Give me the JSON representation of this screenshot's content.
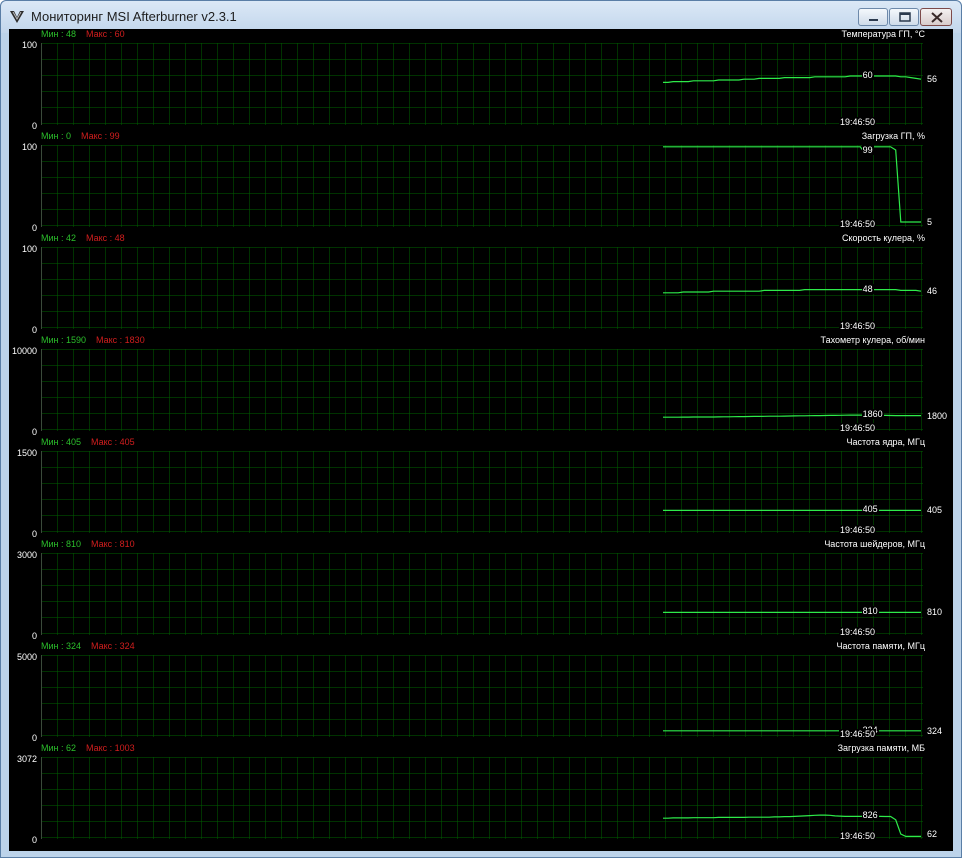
{
  "window": {
    "title": "Мониторинг MSI Afterburner v2.3.1"
  },
  "graph_color": "#2eea4a",
  "panels": [
    {
      "title": "Температура ГП, °C",
      "min_label": "Мин : 48",
      "max_label": "Макс : 60",
      "ymax": "100",
      "ymin": "0",
      "current": "60",
      "last": "56",
      "time": "19:46:50",
      "scale_max": 100,
      "series": [
        52,
        52,
        53,
        53,
        53,
        53,
        54,
        54,
        54,
        54,
        54,
        55,
        55,
        55,
        55,
        55,
        56,
        56,
        56,
        57,
        57,
        57,
        57,
        57,
        58,
        58,
        58,
        58,
        58,
        58,
        59,
        59,
        59,
        59,
        59,
        59,
        59,
        60,
        60,
        60,
        60,
        60,
        60,
        60,
        60,
        60,
        60,
        59,
        59,
        58,
        57,
        56
      ]
    },
    {
      "title": "Загрузка ГП, %",
      "min_label": "Мин : 0",
      "max_label": "Макс : 99",
      "ymax": "100",
      "ymin": "0",
      "current": "99",
      "last": "5",
      "time": "19:46:50",
      "scale_max": 100,
      "series": [
        99,
        99,
        99,
        99,
        99,
        99,
        99,
        99,
        99,
        99,
        99,
        99,
        99,
        99,
        99,
        99,
        99,
        99,
        99,
        99,
        99,
        99,
        99,
        99,
        99,
        99,
        99,
        99,
        99,
        99,
        99,
        99,
        99,
        99,
        99,
        99,
        99,
        99,
        99,
        99,
        90,
        99,
        99,
        99,
        99,
        99,
        95,
        5,
        5,
        5,
        5,
        5
      ]
    },
    {
      "title": "Скорость кулера, %",
      "min_label": "Мин : 42",
      "max_label": "Макс : 48",
      "ymax": "100",
      "ymin": "0",
      "current": "48",
      "last": "46",
      "time": "19:46:50",
      "scale_max": 100,
      "series": [
        44,
        44,
        44,
        44,
        45,
        45,
        45,
        45,
        45,
        45,
        46,
        46,
        46,
        46,
        46,
        46,
        46,
        46,
        46,
        46,
        47,
        47,
        47,
        47,
        47,
        47,
        47,
        47,
        48,
        48,
        48,
        48,
        48,
        48,
        48,
        48,
        48,
        48,
        48,
        48,
        48,
        48,
        48,
        48,
        48,
        48,
        48,
        47,
        47,
        47,
        47,
        46
      ]
    },
    {
      "title": "Тахометр кулера, об/мин",
      "min_label": "Мин : 1590",
      "max_label": "Макс : 1830",
      "ymax": "10000",
      "ymin": "0",
      "current": "1860",
      "last": "1800",
      "time": "19:46:50",
      "scale_max": 10000,
      "series": [
        1600,
        1600,
        1600,
        1600,
        1610,
        1610,
        1620,
        1620,
        1620,
        1630,
        1630,
        1640,
        1650,
        1650,
        1660,
        1670,
        1680,
        1690,
        1700,
        1700,
        1710,
        1720,
        1730,
        1730,
        1740,
        1750,
        1760,
        1770,
        1780,
        1790,
        1800,
        1800,
        1810,
        1820,
        1830,
        1840,
        1850,
        1860,
        1860,
        1860,
        1860,
        1850,
        1840,
        1830,
        1820,
        1810,
        1800,
        1800,
        1800,
        1800,
        1800,
        1800
      ]
    },
    {
      "title": "Частота ядра, МГц",
      "min_label": "Мин : 405",
      "max_label": "Макс : 405",
      "ymax": "1500",
      "ymin": "0",
      "current": "405",
      "last": "405",
      "time": "19:46:50",
      "scale_max": 1500,
      "series": [
        405,
        405,
        405,
        405,
        405,
        405,
        405,
        405,
        405,
        405,
        405,
        405,
        405,
        405,
        405,
        405,
        405,
        405,
        405,
        405,
        405,
        405,
        405,
        405,
        405,
        405,
        405,
        405,
        405,
        405,
        405,
        405,
        405,
        405,
        405,
        405,
        405,
        405,
        405,
        405,
        405,
        405,
        405,
        405,
        405,
        405,
        405,
        405,
        405,
        405,
        405,
        405
      ]
    },
    {
      "title": "Частота шейдеров, МГц",
      "min_label": "Мин : 810",
      "max_label": "Макс : 810",
      "ymax": "3000",
      "ymin": "0",
      "current": "810",
      "last": "810",
      "time": "19:46:50",
      "scale_max": 3000,
      "series": [
        810,
        810,
        810,
        810,
        810,
        810,
        810,
        810,
        810,
        810,
        810,
        810,
        810,
        810,
        810,
        810,
        810,
        810,
        810,
        810,
        810,
        810,
        810,
        810,
        810,
        810,
        810,
        810,
        810,
        810,
        810,
        810,
        810,
        810,
        810,
        810,
        810,
        810,
        810,
        810,
        810,
        810,
        810,
        810,
        810,
        810,
        810,
        810,
        810,
        810,
        810,
        810
      ]
    },
    {
      "title": "Частота памяти, МГц",
      "min_label": "Мин : 324",
      "max_label": "Макс : 324",
      "ymax": "5000",
      "ymin": "0",
      "current": "324",
      "last": "324",
      "time": "19:46:50",
      "scale_max": 5000,
      "series": [
        324,
        324,
        324,
        324,
        324,
        324,
        324,
        324,
        324,
        324,
        324,
        324,
        324,
        324,
        324,
        324,
        324,
        324,
        324,
        324,
        324,
        324,
        324,
        324,
        324,
        324,
        324,
        324,
        324,
        324,
        324,
        324,
        324,
        324,
        324,
        324,
        324,
        324,
        324,
        324,
        324,
        324,
        324,
        324,
        324,
        324,
        324,
        324,
        324,
        324,
        324,
        324
      ]
    },
    {
      "title": "Загрузка памяти, МБ",
      "min_label": "Мин : 62",
      "max_label": "Макс : 1003",
      "ymax": "3072",
      "ymin": "0",
      "current": "826",
      "last": "62",
      "time": "19:46:50",
      "scale_max": 3072,
      "series": [
        760,
        760,
        770,
        770,
        770,
        770,
        780,
        780,
        780,
        780,
        780,
        790,
        790,
        790,
        790,
        790,
        790,
        800,
        800,
        800,
        800,
        800,
        810,
        810,
        820,
        820,
        830,
        840,
        850,
        860,
        870,
        880,
        880,
        870,
        850,
        840,
        830,
        830,
        830,
        830,
        830,
        830,
        830,
        830,
        826,
        826,
        700,
        150,
        62,
        62,
        62,
        62
      ]
    }
  ]
}
